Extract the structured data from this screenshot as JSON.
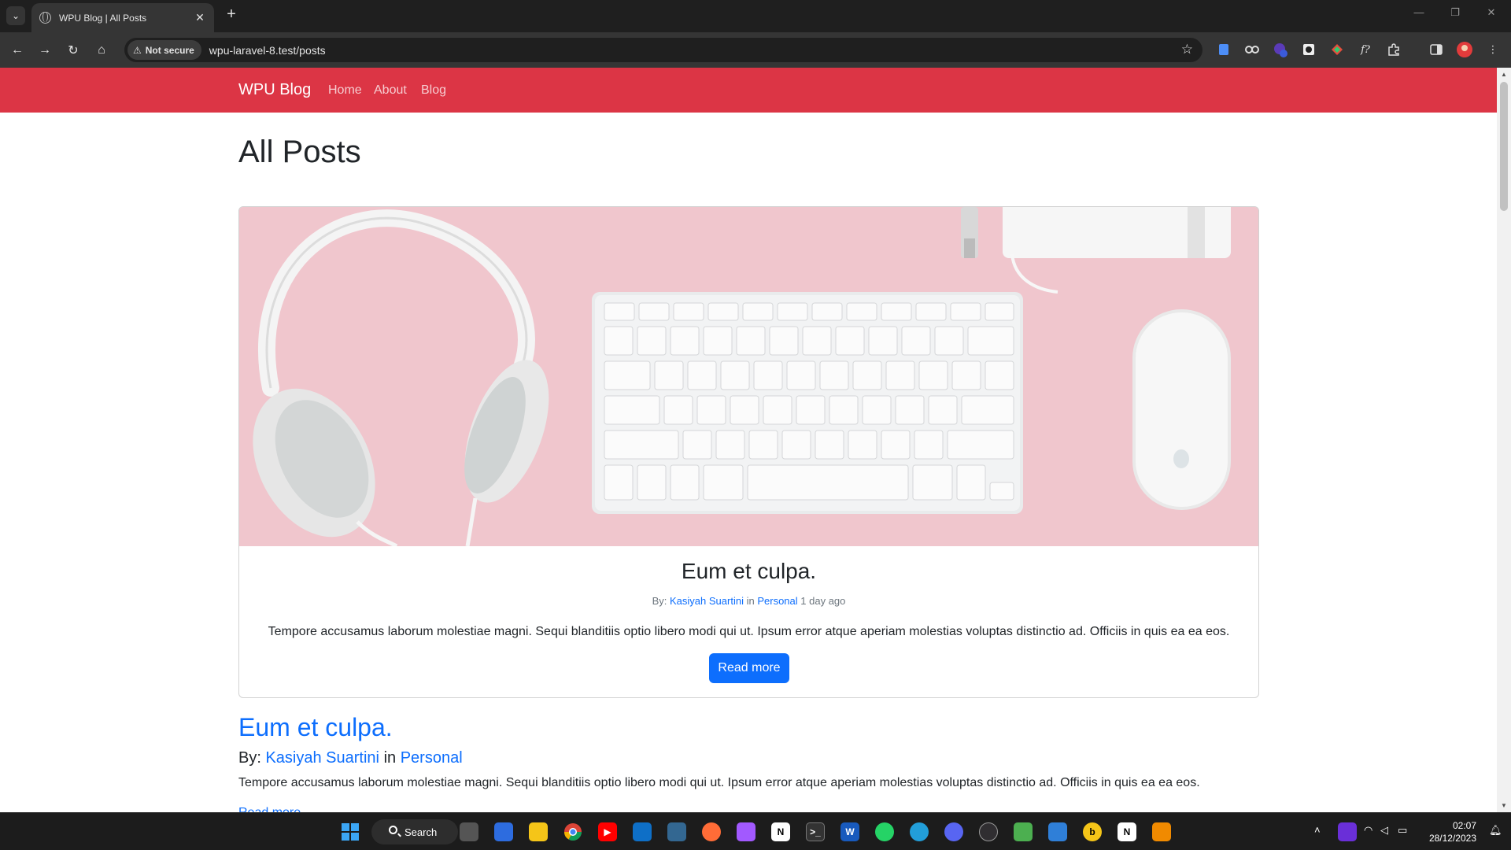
{
  "browser": {
    "tab_title": "WPU Blog | All Posts",
    "tab_close": "✕",
    "new_tab": "+",
    "security_label": "Not secure",
    "url": "wpu-laravel-8.test/posts"
  },
  "navbar": {
    "brand": "WPU Blog",
    "links": [
      "Home",
      "About",
      "Blog"
    ],
    "color": "#dc3545"
  },
  "page": {
    "heading": "All Posts"
  },
  "hero_post": {
    "title": "Eum et culpa.",
    "by_label": "By:",
    "author": "Kasiyah Suartini",
    "in_label": "in",
    "category": "Personal",
    "time_ago": "1 day ago",
    "excerpt": "Tempore accusamus laborum molestiae magni. Sequi blanditiis optio libero modi qui ut. Ipsum error atque aperiam molestias voluptas distinctio ad. Officiis in quis ea ea eos.",
    "button": "Read more"
  },
  "post": {
    "title": "Eum et culpa.",
    "by_label": "By:",
    "author": "Kasiyah Suartini",
    "in_label": "in",
    "category": "Personal",
    "excerpt": "Tempore accusamus laborum molestiae magni. Sequi blanditiis optio libero modi qui ut. Ipsum error atque aperiam molestias voluptas distinctio ad. Officiis in quis ea ea eos.",
    "read_more": "Read more"
  },
  "taskbar": {
    "search_label": "Search",
    "time": "02:07",
    "date": "28/12/2023"
  },
  "colors": {
    "primary": "#0d6efd",
    "danger": "#dc3545"
  }
}
